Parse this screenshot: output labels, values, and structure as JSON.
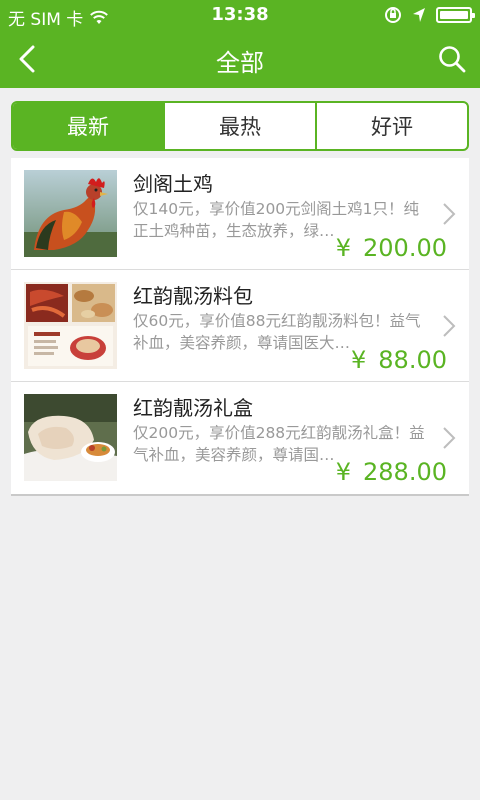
{
  "status_bar": {
    "carrier": "无 SIM 卡",
    "time": "13:38"
  },
  "nav": {
    "title": "全部",
    "back_icon": "chevron-left-icon",
    "search_icon": "search-icon"
  },
  "tabs": [
    {
      "label": "最新",
      "active": true
    },
    {
      "label": "最热",
      "active": false
    },
    {
      "label": "好评",
      "active": false
    }
  ],
  "products": [
    {
      "title": "剑阁土鸡",
      "description": "仅140元，享价值200元剑阁土鸡1只！纯正土鸡种苗，生态放养，绿…",
      "currency": "¥",
      "price": "200.00",
      "image": "rooster"
    },
    {
      "title": "红韵靓汤料包",
      "description": "仅60元，享价值88元红韵靓汤料包！益气补血，美容养颜，尊请国医大…",
      "currency": "¥",
      "price": "88.00",
      "image": "soup-package"
    },
    {
      "title": "红韵靓汤礼盒",
      "description": "仅200元，享价值288元红韵靓汤礼盒！益气补血，美容养颜，尊请国…",
      "currency": "¥",
      "price": "288.00",
      "image": "chicken-dish"
    }
  ],
  "colors": {
    "accent": "#5ab423",
    "background": "#efeff0",
    "muted_text": "#999999"
  }
}
